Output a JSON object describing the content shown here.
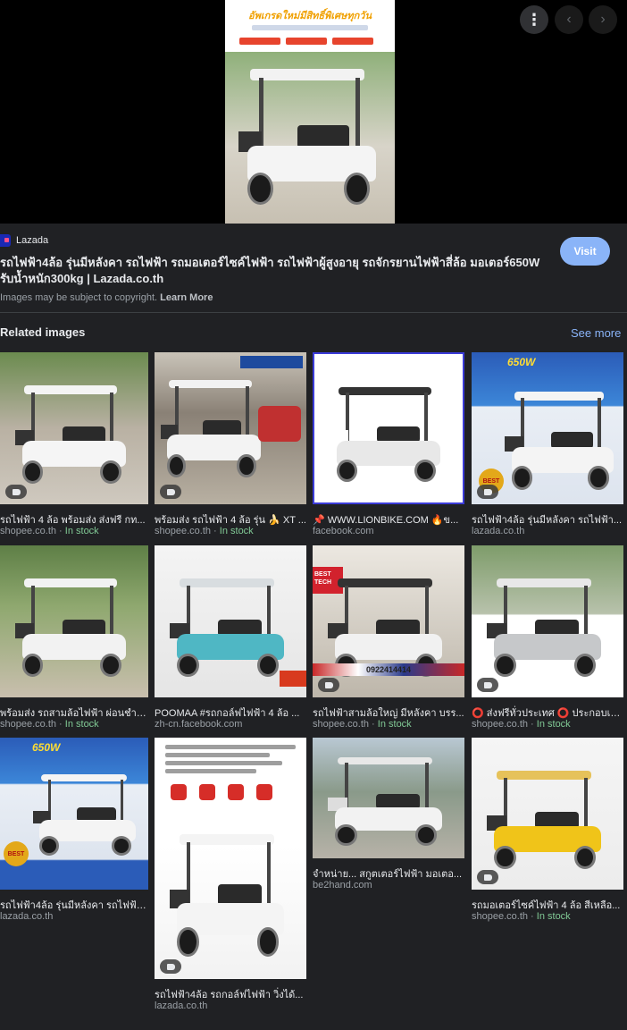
{
  "preview": {
    "headline": "อัพเกรดใหม่มีสิทธิ์พิเศษทุกวัน",
    "more_icon": "more-vert-icon",
    "prev_icon": "chevron-left-icon",
    "next_icon": "chevron-right-icon"
  },
  "source": {
    "name": "Lazada",
    "title": "รถไฟฟ้า4ล้อ รุ่นมีหลังคา รถไฟฟ้า รถมอเตอร์ไซค์ไฟฟ้า รถไฟฟ้าผู้สูงอายุ รถจักรยานไฟฟ้าสี่ล้อ มอเตอร์650W รับน้ำหนัก300kg | Lazada.co.th",
    "visit_label": "Visit",
    "copyright_text": "Images may be subject to copyright.",
    "learn_more": "Learn More"
  },
  "related": {
    "heading": "Related images",
    "see_more": "See more",
    "items": [
      {
        "title": "รถไฟฟ้า 4 ล้อ พร้อมส่ง ส่งฟรี กท...",
        "site": "shopee.co.th",
        "stock": "In stock"
      },
      {
        "title": "พร้อมส่ง รถไฟฟ้า 4 ล้อ รุ่น 🍌 XT ...",
        "site": "shopee.co.th",
        "stock": "In stock"
      },
      {
        "title": "📌 WWW.LIONBIKE.COM 🔥ข...",
        "site": "facebook.com",
        "stock": ""
      },
      {
        "title": "รถไฟฟ้า4ล้อ รุ่นมีหลังคา รถไฟฟ้า...",
        "site": "lazada.co.th",
        "stock": ""
      },
      {
        "title": "พร้อมส่ง รถสามล้อไฟฟ้า ผ่อนชำร...",
        "site": "shopee.co.th",
        "stock": "In stock"
      },
      {
        "title": "POOMAA #รถกอล์ฟไฟฟ้า 4 ล้อ ...",
        "site": "zh-cn.facebook.com",
        "stock": ""
      },
      {
        "title": "รถไฟฟ้าสามล้อใหญ่ มีหลังคา บรร...",
        "site": "shopee.co.th",
        "stock": "In stock"
      },
      {
        "title": "⭕ ส่งฟรีทั่วประเทศ ⭕ ประกอบเรี...",
        "site": "shopee.co.th",
        "stock": "In stock"
      },
      {
        "title": "รถไฟฟ้า4ล้อ รุ่นมีหลังคา รถไฟฟ้า...",
        "site": "lazada.co.th",
        "stock": ""
      },
      {
        "title": "รถไฟฟ้า4ล้อ รถกอล์ฟไฟฟ้า วิ่งได้...",
        "site": "lazada.co.th",
        "stock": ""
      },
      {
        "title": "จำหน่าย... สกูตเตอร์ไฟฟ้า มอเตอ...",
        "site": "be2hand.com",
        "stock": ""
      },
      {
        "title": "รถมอเตอร์ไซค์ไฟฟ้า 4 ล้อ สีเหลือ...",
        "site": "shopee.co.th",
        "stock": "In stock"
      }
    ],
    "overlays": {
      "promo_650w": "650W",
      "phone": "0922414414",
      "best_label": "BEST",
      "best_tech": "BEST TECH"
    }
  },
  "colors": {
    "background": "#202124",
    "link": "#8ab4f8",
    "in_stock": "#81c995",
    "muted": "#9aa0a6"
  }
}
